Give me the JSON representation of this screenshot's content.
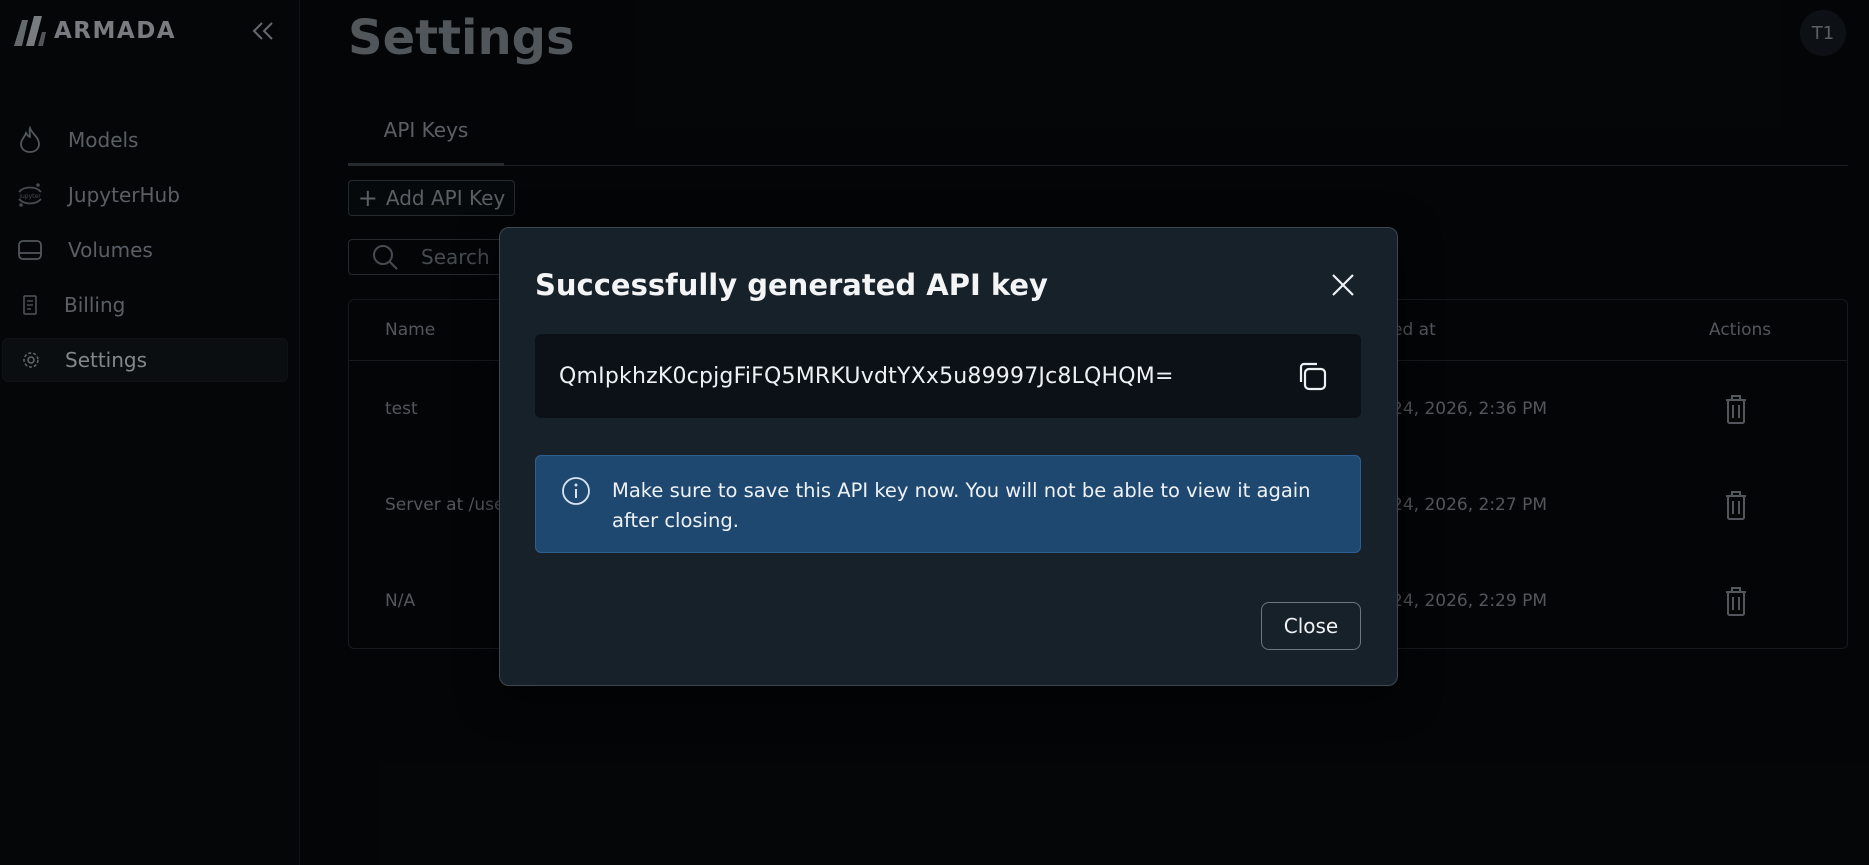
{
  "app": {
    "name": "ARMADA"
  },
  "sidebar": {
    "items": [
      {
        "label": "Models",
        "icon": "flame-icon"
      },
      {
        "label": "JupyterHub",
        "icon": "jupyter-icon"
      },
      {
        "label": "Volumes",
        "icon": "drive-icon"
      },
      {
        "label": "Billing",
        "icon": "receipt-icon"
      },
      {
        "label": "Settings",
        "icon": "gear-icon",
        "active": true
      }
    ]
  },
  "header": {
    "title": "Settings",
    "avatar": "T1"
  },
  "tabs": [
    {
      "label": "API Keys",
      "active": true
    }
  ],
  "toolbar": {
    "add_label": "Add API Key",
    "add_icon": "+"
  },
  "search": {
    "placeholder": "Search"
  },
  "table": {
    "columns": {
      "name": "Name",
      "created": "ed at",
      "actions": "Actions"
    },
    "rows": [
      {
        "name": "test",
        "created": "24, 2026, 2:36 PM"
      },
      {
        "name": "Server at /user",
        "created": "24, 2026, 2:27 PM"
      },
      {
        "name": "N/A",
        "created": "24, 2026, 2:29 PM"
      }
    ]
  },
  "dialog": {
    "title": "Successfully generated API key",
    "api_key": "QmIpkhzK0cpjgFiFQ5MRKUvdtYXx5u89997Jc8LQHQM=",
    "info": "Make sure to save this API key now. You will not be able to view it again after closing.",
    "close_label": "Close"
  },
  "colors": {
    "background": "#06090c",
    "dialog": "#17212a",
    "info": "#1f4870",
    "key_box": "#0b1116"
  }
}
